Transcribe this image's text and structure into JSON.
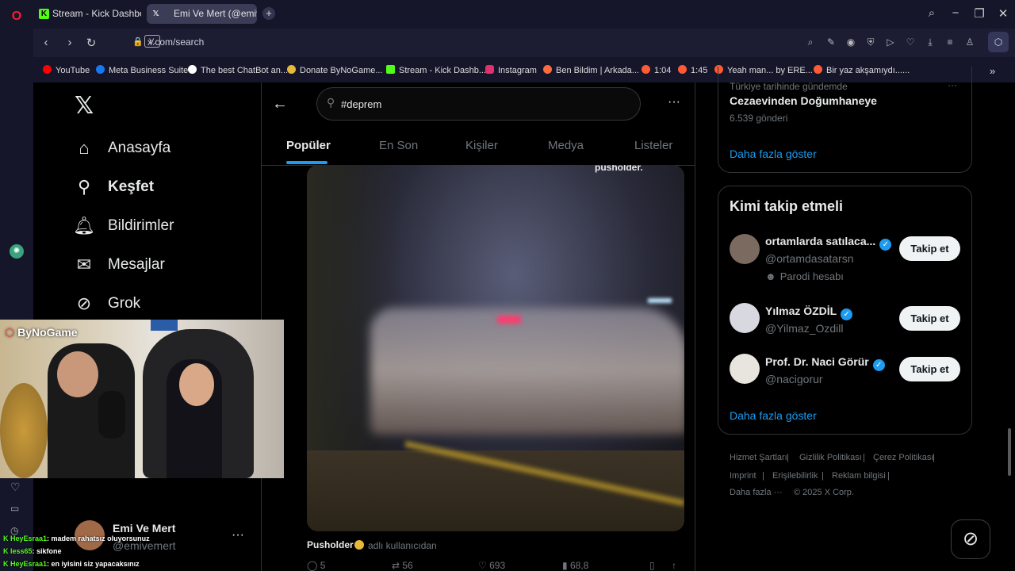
{
  "browser": {
    "tabs": [
      {
        "label": "Stream - Kick Dashboard",
        "icon": "kick-icon",
        "active": false
      },
      {
        "label": "Emi Ve Mert (@emiver",
        "icon": "x-icon",
        "active": true
      }
    ],
    "url": "x.com/search",
    "bookmarks": [
      {
        "label": "YouTube",
        "color": "#ff0000"
      },
      {
        "label": "Meta Business Suite",
        "color": "#1877f2"
      },
      {
        "label": "The best ChatBot an...",
        "color": "#ffffff"
      },
      {
        "label": "Donate ByNoGame...",
        "color": "#e8b839"
      },
      {
        "label": "Stream - Kick Dashb...",
        "color": "#53fc18"
      },
      {
        "label": "Instagram",
        "color": "#e1306c"
      },
      {
        "label": "Ben Bildim | Arkada...",
        "color": "#ff6b3d"
      },
      {
        "label": "1:04",
        "color": "#ff5a36"
      },
      {
        "label": "1:45",
        "color": "#ff5a36"
      },
      {
        "label": "Yeah man... by ERE...",
        "color": "#ff5a36"
      },
      {
        "label": "Bir yaz akşamıydı......",
        "color": "#ff5a36"
      }
    ]
  },
  "x_nav": {
    "items": [
      {
        "label": "Anasayfa",
        "icon": "home-icon"
      },
      {
        "label": "Keşfet",
        "icon": "search-icon"
      },
      {
        "label": "Bildirimler",
        "icon": "bell-icon"
      },
      {
        "label": "Mesajlar",
        "icon": "mail-icon"
      },
      {
        "label": "Grok",
        "icon": "grok-icon"
      }
    ],
    "account": {
      "name": "Emi Ve Mert",
      "handle": "@emivemert"
    }
  },
  "search": {
    "query": "#deprem",
    "tabs": [
      "Popüler",
      "En Son",
      "Kişiler",
      "Medya",
      "Listeler"
    ],
    "active_tab": "Popüler"
  },
  "post": {
    "watermark": "pusholder.",
    "author": "Pusholder",
    "handle": "adlı kullanıcıdan",
    "replies": "5",
    "reposts": "56",
    "likes": "693",
    "views": "68,8"
  },
  "trending": {
    "context": "Türkiye tarihinde gündemde",
    "title": "Cezaevinden Doğumhaneye",
    "count": "6.539 gönderi",
    "show_more": "Daha fazla göster"
  },
  "who_to_follow": {
    "title": "Kimi takip etmeli",
    "button": "Takip et",
    "show_more": "Daha fazla göster",
    "accounts": [
      {
        "name": "ortamlarda satılaca...",
        "handle": "@ortamdasatarsn",
        "note": "Parodi hesabı"
      },
      {
        "name": "Yılmaz ÖZDİL",
        "handle": "@Yilmaz_Ozdill"
      },
      {
        "name": "Prof. Dr. Naci Görür",
        "handle": "@nacigorur"
      }
    ]
  },
  "footer": {
    "links": [
      "Hizmet Şartları",
      "Gizlilik Politikası",
      "Çerez Politikası",
      "Imprint",
      "Erişilebilirlik",
      "Reklam bilgisi",
      "Daha fazla ···"
    ],
    "copyright": "© 2025 X Corp."
  },
  "overlay": {
    "cam_logo": "ByNoGame",
    "chat": [
      {
        "user": "HeyEsraa1",
        "message": ": madem rahatsız oluyorsunuz"
      },
      {
        "user": "less65",
        "message": ": sikfone"
      },
      {
        "user": "HeyEsraa1",
        "message": ": en iyisini siz yapacaksınız"
      }
    ]
  },
  "colors": {
    "accent": "#1d9bf0",
    "background": "#000000",
    "chrome": "#15162a"
  }
}
